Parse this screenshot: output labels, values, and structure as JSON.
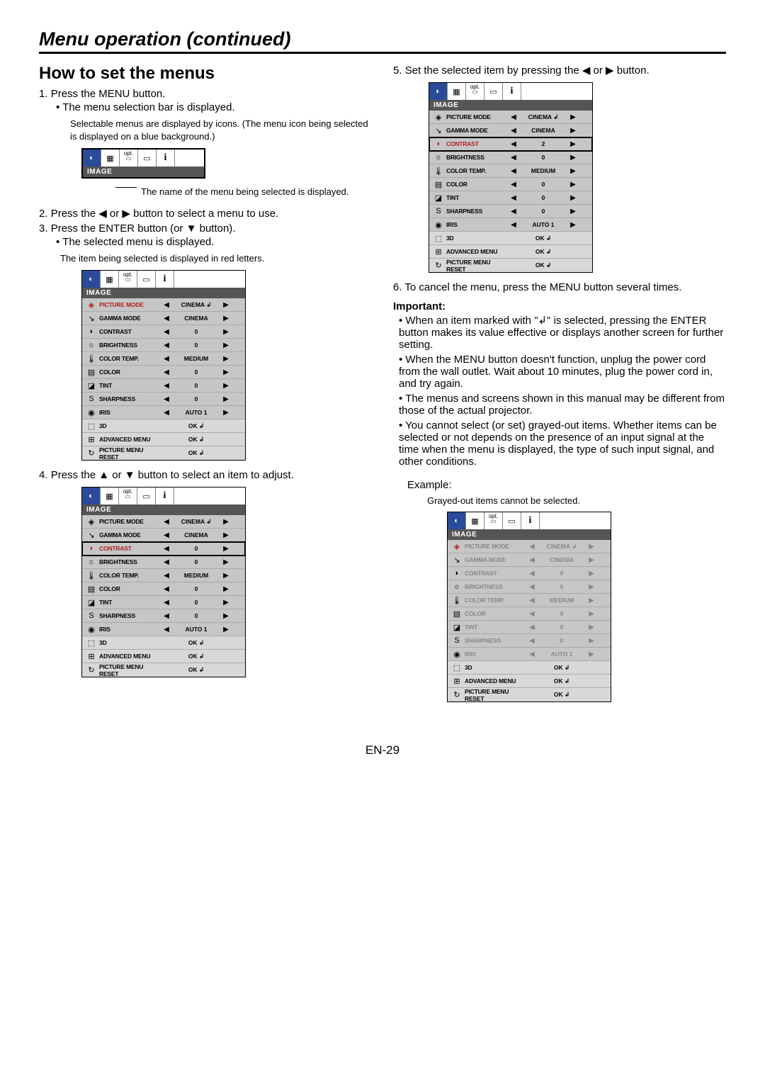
{
  "page": {
    "title": "Menu operation (continued)",
    "section_heading": "How to set the menus",
    "footer": "EN-29"
  },
  "left": {
    "steps": [
      {
        "num": "1.",
        "text": "Press the MENU button.",
        "bullets": [
          "The menu selection bar is displayed."
        ]
      },
      {
        "note": "Selectable menus are displayed by icons. (The menu icon being selected is displayed on a blue background.)"
      },
      {
        "caption": "The name of the menu being selected is displayed."
      },
      {
        "num": "2.",
        "text": "Press the ◀ or ▶ button to select a menu to use."
      },
      {
        "num": "3.",
        "text": "Press the ENTER button (or ▼ button).",
        "bullets": [
          "The selected menu is displayed."
        ]
      },
      {
        "note2": "The item being selected is displayed in red letters."
      },
      {
        "num": "4.",
        "text": "Press the ▲ or ▼ button to select an item to adjust."
      }
    ]
  },
  "right": {
    "steps": [
      {
        "num": "5.",
        "text": "Set the selected item by pressing the ◀ or ▶ button."
      },
      {
        "num": "6.",
        "text": "To cancel the menu, press the MENU button several times."
      }
    ],
    "important_label": "Important:",
    "important": [
      "When an item marked with \"↲\" is selected, pressing the ENTER button makes its value effective or displays another screen for further setting.",
      "When the MENU button doesn't function, unplug the power cord from the wall outlet. Wait about 10 minutes, plug the power cord in, and try again.",
      "The menus and screens shown in this manual may be different from those of the actual projector.",
      "You cannot select (or set) grayed-out items. Whether items can be selected or not depends on the presence of an input signal at the time when the menu is displayed, the type of such input signal, and other conditions."
    ],
    "example_label": "Example:",
    "grayed_note": "Grayed-out items cannot be selected."
  },
  "menu": {
    "label": "IMAGE",
    "tabs": [
      "◐",
      "▦",
      "opt",
      "▭",
      "i"
    ],
    "rows": [
      {
        "icon": "◈",
        "name": "PICTURE MODE",
        "val": "CINEMA ↲",
        "arrows": true
      },
      {
        "icon": "↘",
        "name": "GAMMA MODE",
        "val": "CINEMA",
        "arrows": true
      },
      {
        "icon": "◗",
        "name": "CONTRAST",
        "val": "0",
        "arrows": true
      },
      {
        "icon": "☼",
        "name": "BRIGHTNESS",
        "val": "0",
        "arrows": true
      },
      {
        "icon": "🌡",
        "name": "COLOR TEMP.",
        "val": "MEDIUM",
        "arrows": true
      },
      {
        "icon": "▤",
        "name": "COLOR",
        "val": "0",
        "arrows": true
      },
      {
        "icon": "◪",
        "name": "TINT",
        "val": "0",
        "arrows": true
      },
      {
        "icon": "S",
        "name": "SHARPNESS",
        "val": "0",
        "arrows": true
      },
      {
        "icon": "◉",
        "name": "IRIS",
        "val": "AUTO 1",
        "arrows": true
      },
      {
        "icon": "⬚",
        "name": "3D",
        "val": "OK ↲",
        "arrows": false
      },
      {
        "icon": "⊞",
        "name": "ADVANCED MENU",
        "val": "OK ↲",
        "arrows": false
      },
      {
        "icon": "↻",
        "name": "PICTURE MENU RESET",
        "val": "OK ↲",
        "arrows": false
      }
    ],
    "contrast_val_step5": "2"
  }
}
